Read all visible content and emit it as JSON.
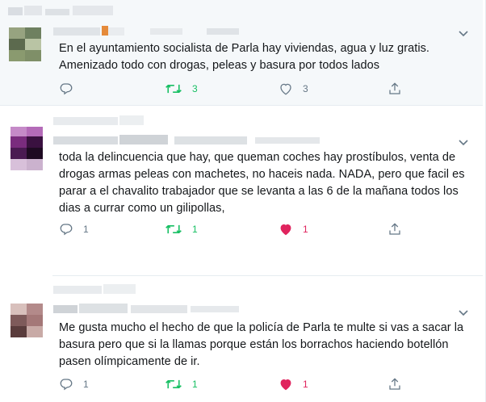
{
  "tweets": [
    {
      "text": "En el ayuntamiento socialista de Parla hay viviendas, agua y luz gratis.\nAmenizado todo con drogas, peleas y basura por todos lados",
      "replies": "",
      "retweets": "3",
      "likes": "3",
      "liked": false,
      "highlighted": true,
      "avatar_colors": [
        "#8a9a6f",
        "#6e8060",
        "#b9c4a4",
        "#5c6a4e"
      ]
    },
    {
      "text": "toda la delincuencia que hay, que queman coches hay prostíbulos, venta de\ndrogas armas peleas con machetes, no haceis nada. NADA, pero que facil es\nparar a el chavalito trabajador que se levanta a las 6 de la mañana todos los\ndias a currar como un gilipollas,",
      "replies": "1",
      "retweets": "1",
      "likes": "1",
      "liked": true,
      "highlighted": false,
      "avatar_colors": [
        "#7a2c7e",
        "#3a1140",
        "#b46bb8",
        "#1e0a22"
      ]
    },
    {
      "text": "Me gusta mucho el hecho de que la policía de Parla te multe si vas a sacar la\nbasura pero que si la llamas porque están los borrachos haciendo botellón\npasen olímpicamente de ir.",
      "replies": "1",
      "retweets": "1",
      "likes": "1",
      "liked": true,
      "highlighted": false,
      "avatar_colors": [
        "#b38a8a",
        "#7e5a5a",
        "#d8c0bc",
        "#5a3c3c"
      ]
    }
  ],
  "colors": {
    "retweet": "#17bf63",
    "like": "#e0245e",
    "icon": "#657786",
    "text": "#14171a"
  },
  "icons": [
    "reply-icon",
    "retweet-icon",
    "like-icon",
    "share-icon",
    "chevron-down-icon"
  ]
}
